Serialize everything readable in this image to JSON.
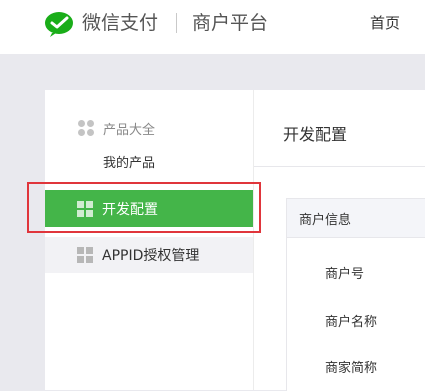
{
  "header": {
    "brand": "微信支付",
    "platform": "商户平台",
    "nav_home": "首页"
  },
  "sidebar": {
    "category": "产品大全",
    "my_products": "我的产品",
    "active_item": "开发配置",
    "appid_item": "APPID授权管理"
  },
  "main": {
    "title": "开发配置",
    "card_title": "商户信息",
    "rows": [
      "商户号",
      "商户名称",
      "商家简称"
    ]
  },
  "colors": {
    "accent": "#44b549",
    "highlight": "#e0353b"
  },
  "icons": [
    "wechat-pay-logo-icon",
    "dots-icon",
    "grid-icon"
  ]
}
